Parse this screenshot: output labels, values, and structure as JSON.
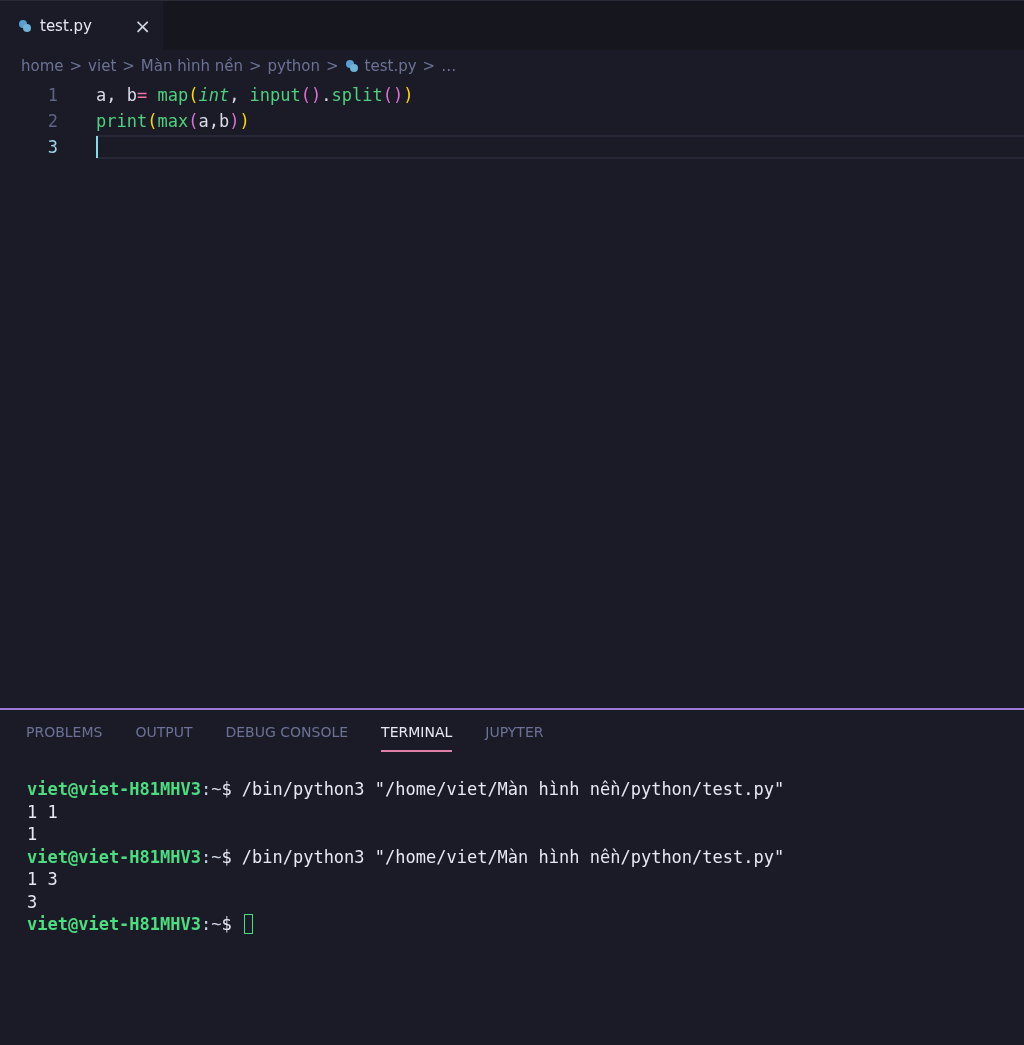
{
  "tabs": [
    {
      "label": "test.py",
      "close": "×",
      "selected": true
    }
  ],
  "breadcrumb": [
    {
      "label": "home",
      "kind": "folder"
    },
    {
      "label": "viet",
      "kind": "folder"
    },
    {
      "label": "Màn hình nền",
      "kind": "folder"
    },
    {
      "label": "python",
      "kind": "folder"
    },
    {
      "label": "test.py",
      "kind": "file"
    },
    {
      "label": "…",
      "kind": "more"
    }
  ],
  "breadcrumb_separator": ">",
  "editor": {
    "lines": [
      {
        "number": "1",
        "selected": false,
        "tokens": [
          {
            "text": "a, b",
            "kind": "plain"
          },
          {
            "text": "= ",
            "kind": "op"
          },
          {
            "text": "map",
            "kind": "fn"
          },
          {
            "text": "(",
            "kind": "b1"
          },
          {
            "text": "int",
            "kind": "type"
          },
          {
            "text": ", ",
            "kind": "plain"
          },
          {
            "text": "input",
            "kind": "fn"
          },
          {
            "text": "()",
            "kind": "b2"
          },
          {
            "text": ".",
            "kind": "plain"
          },
          {
            "text": "split",
            "kind": "fn"
          },
          {
            "text": "()",
            "kind": "b2"
          },
          {
            "text": ")",
            "kind": "b1"
          }
        ]
      },
      {
        "number": "2",
        "selected": false,
        "tokens": [
          {
            "text": "print",
            "kind": "fn"
          },
          {
            "text": "(",
            "kind": "b1"
          },
          {
            "text": "max",
            "kind": "fn"
          },
          {
            "text": "(",
            "kind": "b2"
          },
          {
            "text": "a,b",
            "kind": "plain"
          },
          {
            "text": ")",
            "kind": "b2"
          },
          {
            "text": ")",
            "kind": "b1"
          }
        ]
      },
      {
        "number": "3",
        "selected": true
      }
    ]
  },
  "panel_tabs": [
    {
      "label": "PROBLEMS",
      "selected": false
    },
    {
      "label": "OUTPUT",
      "selected": false
    },
    {
      "label": "DEBUG CONSOLE",
      "selected": false
    },
    {
      "label": "TERMINAL",
      "selected": true
    },
    {
      "label": "JUPYTER",
      "selected": false
    }
  ],
  "terminal": [
    {
      "kind": "prompt",
      "user": "viet@viet-H81MHV3",
      "colon": ":",
      "path": "~",
      "dollar": "$",
      "command": "/bin/python3 \"/home/viet/Màn hình nền/python/test.py\""
    },
    {
      "kind": "output",
      "text": "1 1"
    },
    {
      "kind": "output",
      "text": "1"
    },
    {
      "kind": "prompt",
      "user": "viet@viet-H81MHV3",
      "colon": ":",
      "path": "~",
      "dollar": "$",
      "command": "/bin/python3 \"/home/viet/Màn hình nền/python/test.py\""
    },
    {
      "kind": "output",
      "text": "1 3"
    },
    {
      "kind": "output",
      "text": "3"
    },
    {
      "kind": "prompt",
      "user": "viet@viet-H81MHV3",
      "colon": ":",
      "path": "~",
      "dollar": "$",
      "cursor": true
    }
  ]
}
